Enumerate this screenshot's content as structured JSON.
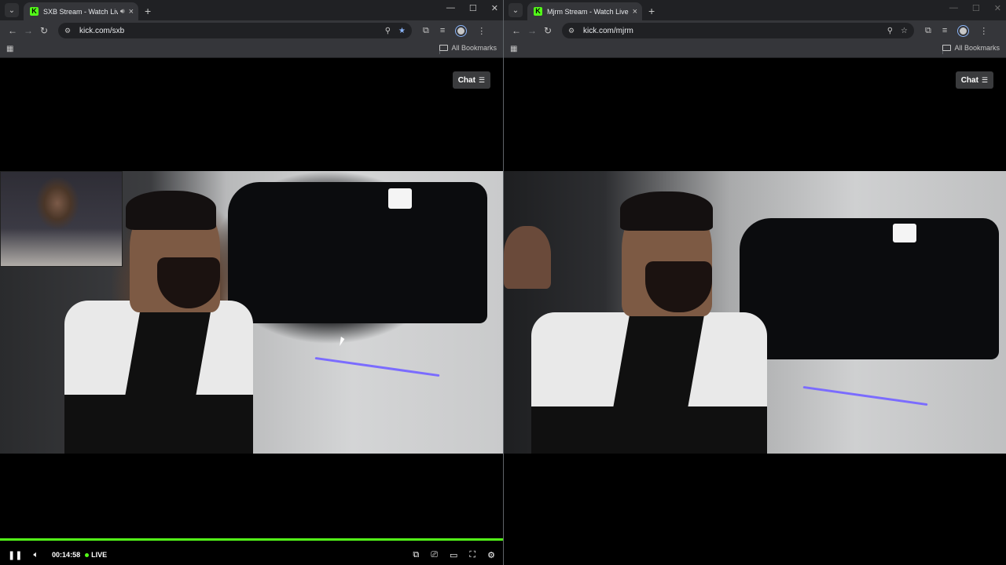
{
  "left_window": {
    "tab": {
      "title": "SXB Stream - Watch Live on Kick",
      "favicon": "K",
      "has_audio": true
    },
    "url": "kick.com/sxb",
    "bookmarks_label": "All Bookmarks",
    "chat_label": "Chat",
    "player": {
      "time": "00:14:58",
      "live_label": "LIVE",
      "progress": 1.0
    }
  },
  "right_window": {
    "tab": {
      "title": "Mjrm Stream - Watch Live on Kick",
      "favicon": "K"
    },
    "url": "kick.com/mjrm",
    "bookmarks_label": "All Bookmarks",
    "chat_label": "Chat"
  },
  "colors": {
    "accent": "#53fc18",
    "chrome_bg": "#35363a",
    "tabstrip_bg": "#202124"
  }
}
